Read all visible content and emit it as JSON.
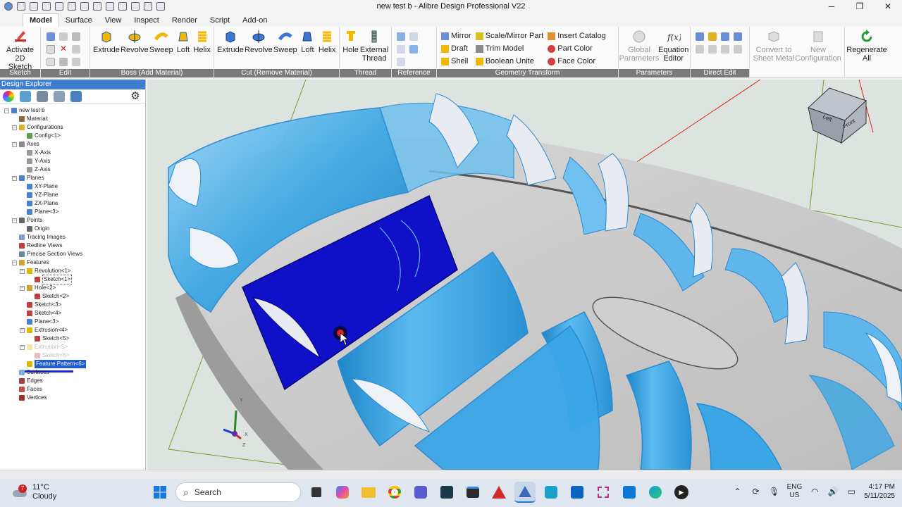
{
  "window": {
    "title": "new test b - Alibre Design Professional V22",
    "minimize": "─",
    "maximize": "❐",
    "close": "✕"
  },
  "ribbon_tabs": [
    "Model",
    "Surface",
    "View",
    "Inspect",
    "Render",
    "Script",
    "Add-on"
  ],
  "ribbon": {
    "sketch": {
      "label": "Sketch",
      "activate": "Activate 2D Sketch"
    },
    "edit": {
      "label": "Edit"
    },
    "boss": {
      "label": "Boss (Add Material)",
      "buttons": [
        "Extrude",
        "Revolve",
        "Sweep",
        "Loft",
        "Helix"
      ]
    },
    "cut": {
      "label": "Cut (Remove Material)",
      "buttons": [
        "Extrude",
        "Revolve",
        "Sweep",
        "Loft",
        "Helix"
      ]
    },
    "thread": {
      "label": "Thread",
      "hole": "Hole",
      "external": "External Thread"
    },
    "reference": {
      "label": "Reference"
    },
    "geometry": {
      "label": "Geometry Transform",
      "col1": [
        "Mirror",
        "Draft",
        "Shell"
      ],
      "col2": [
        "Scale/Mirror Part",
        "Trim Model",
        "Boolean Unite"
      ],
      "col3": [
        "Insert Catalog",
        "Part Color",
        "Face Color"
      ]
    },
    "parameters": {
      "label": "Parameters",
      "global": "Global Parameters",
      "equation": "Equation Editor"
    },
    "direct": {
      "label": "Direct Edit"
    },
    "extra": {
      "convert": "Convert to Sheet Metal",
      "newconfig": "New Configuration",
      "regenerate": "Regenerate All"
    }
  },
  "explorer": {
    "title": "Design Explorer",
    "tree": [
      {
        "label": "new test b",
        "depth": 0,
        "icon": "part-icon"
      },
      {
        "label": "Material:",
        "depth": 1,
        "icon": "material-icon"
      },
      {
        "label": "Configurations",
        "depth": 1,
        "icon": "folder-icon"
      },
      {
        "label": "Config<1>",
        "depth": 2,
        "icon": "config-icon"
      },
      {
        "label": "Axes",
        "depth": 1,
        "icon": "axes-icon"
      },
      {
        "label": "X-Axis",
        "depth": 2,
        "icon": "axis-icon"
      },
      {
        "label": "Y-Axis",
        "depth": 2,
        "icon": "axis-icon"
      },
      {
        "label": "Z-Axis",
        "depth": 2,
        "icon": "axis-icon"
      },
      {
        "label": "Planes",
        "depth": 1,
        "icon": "plane-icon"
      },
      {
        "label": "XY-Plane",
        "depth": 2,
        "icon": "plane-icon"
      },
      {
        "label": "YZ-Plane",
        "depth": 2,
        "icon": "plane-icon"
      },
      {
        "label": "ZX-Plane",
        "depth": 2,
        "icon": "plane-icon"
      },
      {
        "label": "Plane<3>",
        "depth": 2,
        "icon": "plane-icon"
      },
      {
        "label": "Points",
        "depth": 1,
        "icon": "point-icon"
      },
      {
        "label": "Origin",
        "depth": 2,
        "icon": "point-icon"
      },
      {
        "label": "Tracing Images",
        "depth": 1,
        "icon": "image-icon"
      },
      {
        "label": "Redline Views",
        "depth": 1,
        "icon": "redline-icon"
      },
      {
        "label": "Precise Section Views",
        "depth": 1,
        "icon": "section-icon"
      },
      {
        "label": "Features",
        "depth": 1,
        "icon": "features-icon"
      },
      {
        "label": "Revolution<1>",
        "depth": 2,
        "icon": "revolve-icon"
      },
      {
        "label": "Sketch<1>",
        "depth": 3,
        "icon": "sketch-icon",
        "boxed": true
      },
      {
        "label": "Hole<2>",
        "depth": 2,
        "icon": "hole-icon"
      },
      {
        "label": "Sketch<2>",
        "depth": 3,
        "icon": "sketch-icon"
      },
      {
        "label": "Sketch<3>",
        "depth": 2,
        "icon": "sketch-icon"
      },
      {
        "label": "Sketch<4>",
        "depth": 2,
        "icon": "sketch-icon"
      },
      {
        "label": "Plane<3>",
        "depth": 2,
        "icon": "plane-icon"
      },
      {
        "label": "Extrusion<4>",
        "depth": 2,
        "icon": "extrude-icon"
      },
      {
        "label": "Sketch<5>",
        "depth": 3,
        "icon": "sketch-icon"
      },
      {
        "label": "Extrusion<5>",
        "depth": 2,
        "icon": "extrude-icon",
        "dim": true
      },
      {
        "label": "Sketch<6>",
        "depth": 3,
        "icon": "sketch-icon",
        "dim": true
      },
      {
        "label": "Feature Pattern<6>",
        "depth": 2,
        "icon": "pattern-icon",
        "selected": true
      },
      {
        "label": "Surfaces",
        "depth": 1,
        "icon": "surface-icon"
      },
      {
        "label": "Edges",
        "depth": 1,
        "icon": "edge-icon"
      },
      {
        "label": "Faces",
        "depth": 1,
        "icon": "face-icon"
      },
      {
        "label": "Vertices",
        "depth": 1,
        "icon": "vertex-icon"
      }
    ]
  },
  "viewcube": {
    "left": "Left",
    "front": "Front"
  },
  "triad": {
    "x": "X",
    "y": "Y",
    "z": "Z"
  },
  "taskbar": {
    "weather_temp": "11°C",
    "weather_desc": "Cloudy",
    "weather_badge": "7",
    "search_placeholder": "Search",
    "lang1": "ENG",
    "lang2": "US",
    "time": "4:17 PM",
    "date": "5/11/2025"
  },
  "colors": {
    "accent": "#1e5bd0",
    "model_blue": "#3aa6e6",
    "selected_face": "#1010c8",
    "viewport_bg": "#dde3df"
  }
}
